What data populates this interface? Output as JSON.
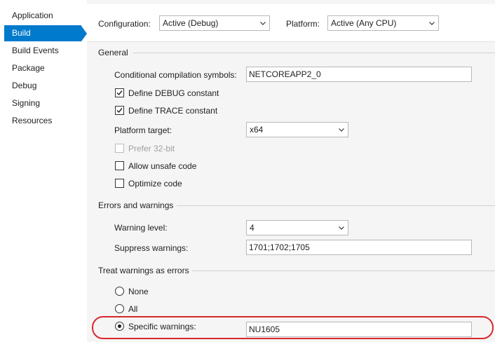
{
  "sidebar": {
    "items": [
      {
        "label": "Application"
      },
      {
        "label": "Build"
      },
      {
        "label": "Build Events"
      },
      {
        "label": "Package"
      },
      {
        "label": "Debug"
      },
      {
        "label": "Signing"
      },
      {
        "label": "Resources"
      }
    ],
    "active": "Build"
  },
  "toolbar": {
    "configuration_label": "Configuration:",
    "configuration_value": "Active (Debug)",
    "platform_label": "Platform:",
    "platform_value": "Active (Any CPU)"
  },
  "general": {
    "heading": "General",
    "conditional_symbols_label": "Conditional compilation symbols:",
    "conditional_symbols_value": "NETCOREAPP2_0",
    "define_debug_label": "Define DEBUG constant",
    "define_debug_checked": true,
    "define_trace_label": "Define TRACE constant",
    "define_trace_checked": true,
    "platform_target_label": "Platform target:",
    "platform_target_value": "x64",
    "prefer32_label": "Prefer 32-bit",
    "prefer32_enabled": false,
    "allow_unsafe_label": "Allow unsafe code",
    "allow_unsafe_checked": false,
    "optimize_label": "Optimize code",
    "optimize_checked": false
  },
  "errors": {
    "heading": "Errors and warnings",
    "warning_level_label": "Warning level:",
    "warning_level_value": "4",
    "suppress_label": "Suppress warnings:",
    "suppress_value": "1701;1702;1705"
  },
  "treat": {
    "heading": "Treat warnings as errors",
    "none_label": "None",
    "all_label": "All",
    "specific_label": "Specific warnings:",
    "specific_value": "NU1605",
    "selected": "specific"
  },
  "colors": {
    "accent": "#007acc",
    "highlight_annotation": "#d9272e"
  }
}
